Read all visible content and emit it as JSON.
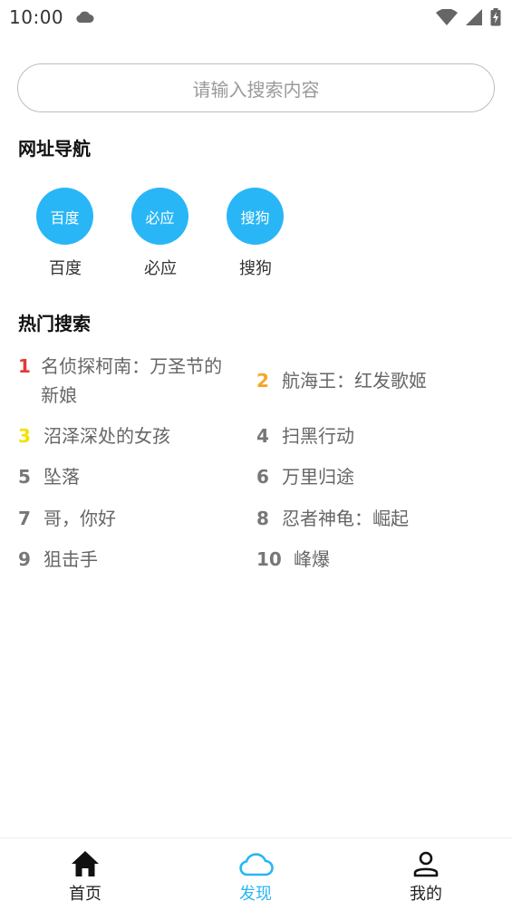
{
  "status_bar": {
    "time": "10:00"
  },
  "search": {
    "placeholder": "请输入搜索内容"
  },
  "nav_section": {
    "title": "网址导航",
    "items": [
      {
        "circle_text": "百度",
        "label": "百度"
      },
      {
        "circle_text": "必应",
        "label": "必应"
      },
      {
        "circle_text": "搜狗",
        "label": "搜狗"
      }
    ]
  },
  "hot_section": {
    "title": "热门搜索",
    "items": [
      {
        "rank": "1",
        "text": "名侦探柯南：万圣节的新娘"
      },
      {
        "rank": "2",
        "text": "航海王：红发歌姬"
      },
      {
        "rank": "3",
        "text": "沼泽深处的女孩"
      },
      {
        "rank": "4",
        "text": "扫黑行动"
      },
      {
        "rank": "5",
        "text": "坠落"
      },
      {
        "rank": "6",
        "text": "万里归途"
      },
      {
        "rank": "7",
        "text": "哥，你好"
      },
      {
        "rank": "8",
        "text": "忍者神龟：崛起"
      },
      {
        "rank": "9",
        "text": "狙击手"
      },
      {
        "rank": "10",
        "text": "峰爆"
      }
    ]
  },
  "bottom_nav": {
    "tabs": [
      {
        "label": "首页",
        "icon": "home-icon",
        "active": false
      },
      {
        "label": "发现",
        "icon": "cloud-icon",
        "active": true
      },
      {
        "label": "我的",
        "icon": "user-icon",
        "active": false
      }
    ]
  },
  "colors": {
    "accent": "#29b6f6",
    "rank1": "#e53935",
    "rank2": "#f5a623",
    "rank3": "#f2e200",
    "rank_default": "#777777"
  }
}
